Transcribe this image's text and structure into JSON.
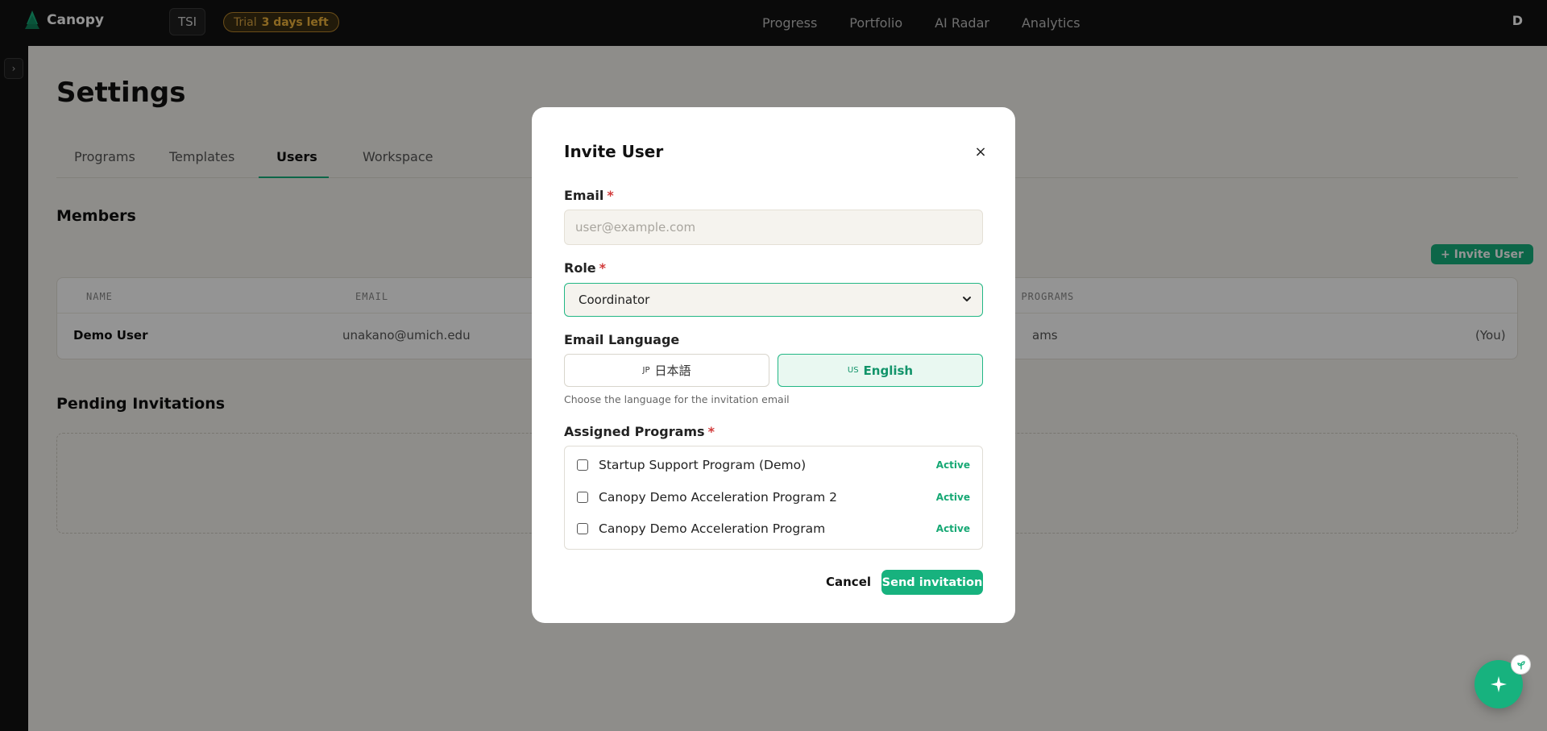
{
  "topbar": {
    "brand": "Canopy",
    "workspace_badge": "TSI",
    "trial_label": "Trial",
    "trial_days": "3 days left",
    "nav": [
      "Progress",
      "Portfolio",
      "AI Radar",
      "Analytics"
    ],
    "avatar": "D"
  },
  "sidebar": {
    "toggle_icon": "›"
  },
  "page": {
    "title": "Settings",
    "tabs": [
      "Programs",
      "Templates",
      "Users",
      "Workspace"
    ],
    "active_tab": "Users",
    "members_heading": "Members",
    "invite_button": "+ Invite User",
    "table": {
      "headers": [
        "NAME",
        "EMAIL",
        "D PROGRAMS"
      ],
      "rows": [
        {
          "name": "Demo User",
          "email": "unakano@umich.edu",
          "programs": "ams",
          "you": "(You)"
        }
      ]
    },
    "pending_heading": "Pending Invitations"
  },
  "modal": {
    "title": "Invite User",
    "close_icon": "×",
    "email_label": "Email",
    "email_placeholder": "user@example.com",
    "email_value": "",
    "role_label": "Role",
    "role_value": "Coordinator",
    "language_label": "Email Language",
    "languages": [
      {
        "flag": "JP",
        "label": "日本語",
        "selected": false
      },
      {
        "flag": "US",
        "label": "English",
        "selected": true
      }
    ],
    "language_hint": "Choose the language for the invitation email",
    "programs_label": "Assigned Programs",
    "programs": [
      {
        "name": "Startup Support Program (Demo)",
        "status": "Active"
      },
      {
        "name": "Canopy Demo Acceleration Program 2",
        "status": "Active"
      },
      {
        "name": "Canopy Demo Acceleration Program",
        "status": "Active"
      }
    ],
    "cancel_label": "Cancel",
    "send_label": "Send invitation"
  },
  "assistant": {
    "icon": "sparkle-icon",
    "badge_icon": "sprout-icon"
  },
  "colors": {
    "accent": "#17b27e",
    "trial": "#f0b43c",
    "required": "#d23b3b"
  }
}
